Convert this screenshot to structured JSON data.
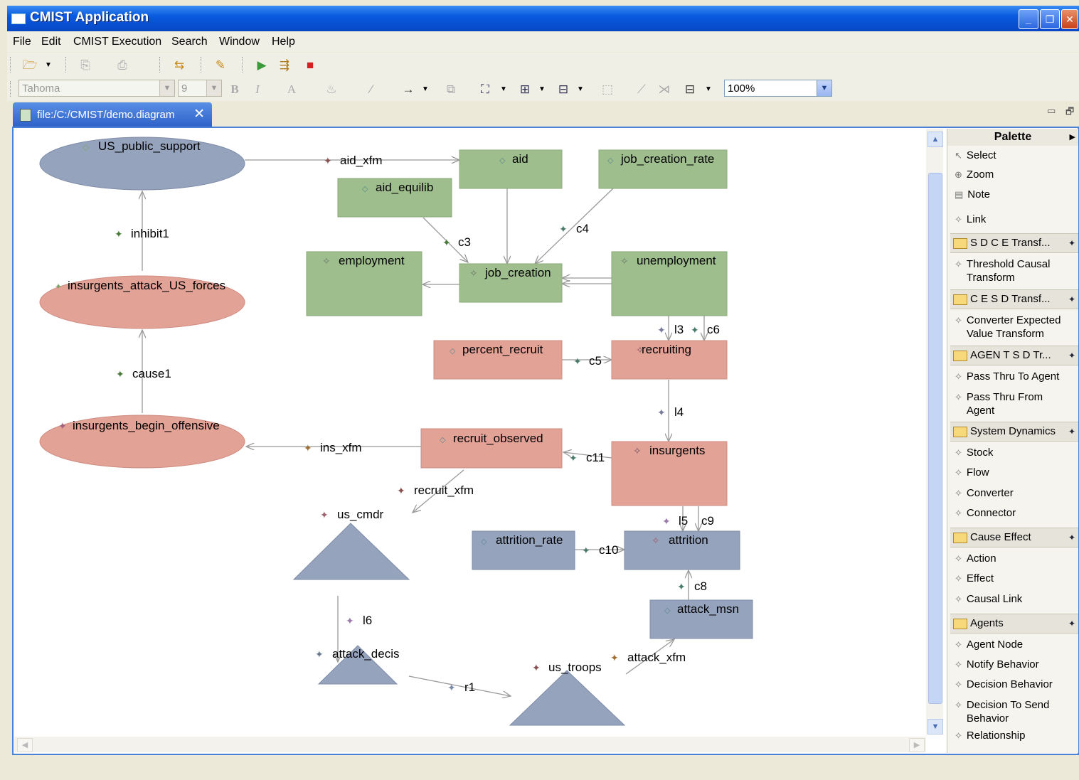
{
  "window": {
    "title": "CMIST Application"
  },
  "menu": [
    "File",
    "Edit",
    "CMIST Execution",
    "Search",
    "Window",
    "Help"
  ],
  "format_toolbar": {
    "font_name": "Tahoma",
    "font_size": "9",
    "zoom": "100%"
  },
  "editor_tab": {
    "label": "file:/C:/CMIST/demo.diagram"
  },
  "palette": {
    "title": "Palette",
    "tools": [
      "Select",
      "Zoom",
      "Note"
    ],
    "link": "Link",
    "drawers": [
      {
        "name": "S D C E Transf...",
        "items": [
          "Threshold Causal Transform"
        ]
      },
      {
        "name": "C E S D Transf...",
        "items": [
          "Converter Expected Value Transform"
        ]
      },
      {
        "name": "AGEN T S D Tr...",
        "items": [
          "Pass Thru To Agent",
          "Pass Thru From Agent"
        ]
      },
      {
        "name": "System Dynamics",
        "items": [
          "Stock",
          "Flow",
          "Converter",
          "Connector"
        ]
      },
      {
        "name": "Cause Effect",
        "items": [
          "Action",
          "Effect",
          "Causal Link"
        ]
      },
      {
        "name": "Agents",
        "items": [
          "Agent Node",
          "Notify Behavior",
          "Decision Behavior",
          "Decision To Send Behavior",
          "Relationship"
        ]
      }
    ]
  },
  "diagram": {
    "ellipses": [
      "US_public_support",
      "insurgents_attack_US_forces",
      "insurgents_begin_offensive"
    ],
    "green_nodes": [
      "aid",
      "job_creation_rate",
      "aid_equilib",
      "employment",
      "job_creation",
      "unemployment"
    ],
    "red_nodes": [
      "percent_recruit",
      "recruiting",
      "recruit_observed",
      "insurgents"
    ],
    "blue_nodes": [
      "attrition_rate",
      "attrition",
      "attack_msn"
    ],
    "triangles": [
      "us_cmdr",
      "attack_decis",
      "us_troops"
    ],
    "link_labels": [
      "aid_xfm",
      "inhibit1",
      "cause1",
      "c3",
      "c4",
      "l3",
      "c6",
      "c5",
      "l4",
      "ins_xfm",
      "c11",
      "recruit_xfm",
      "l5",
      "c9",
      "c10",
      "c8",
      "l6",
      "attack_xfm",
      "r1"
    ]
  },
  "colors": {
    "green_node": "#9fbe8e",
    "red_node": "#e3a296",
    "blue_node": "#96a3bd",
    "title_bar": "#0a5ae0"
  }
}
